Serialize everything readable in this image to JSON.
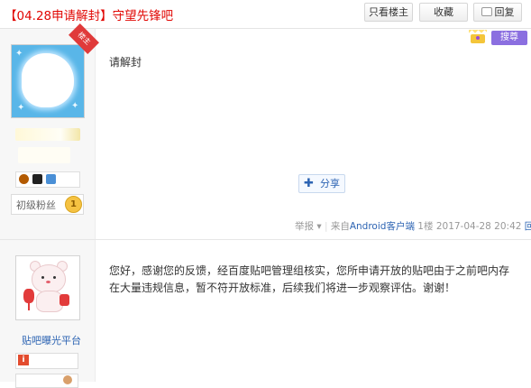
{
  "header": {
    "title": "【04.28申请解封】守望先锋吧",
    "only_louzhu": "只看楼主",
    "favorite": "收藏",
    "reply": "回复"
  },
  "post1": {
    "ribbon_label": "楼主",
    "level_name": "初级粉丝",
    "level_num": "1",
    "content": "请解封",
    "share_label": "分享",
    "report": "举报",
    "source_prefix": "来自",
    "source_client": "Android客户端",
    "floor": "1楼",
    "time": "2017-04-28 20:42",
    "reply_label": "回复",
    "search_badge": "搜尊"
  },
  "post2": {
    "author_name": "贴吧曝光平台",
    "warn_icon": "i",
    "content": "您好，感谢您的反馈，经百度贴吧管理组核实，您所申请开放的贴吧由于之前吧内存在大量违规信息，暂不符开放标准，后续我们将进一步观察评估。谢谢！"
  },
  "icons": {
    "crown": "crown-icon",
    "share": "plus-icon",
    "reply": "comment-icon",
    "warn": "warning-icon"
  },
  "colors": {
    "title_red": "#e10602",
    "link_blue": "#2d64b3",
    "meta_gray": "#999999",
    "avatar_bg": "#59b6e8",
    "badge_purple": "#8b6fe0"
  }
}
